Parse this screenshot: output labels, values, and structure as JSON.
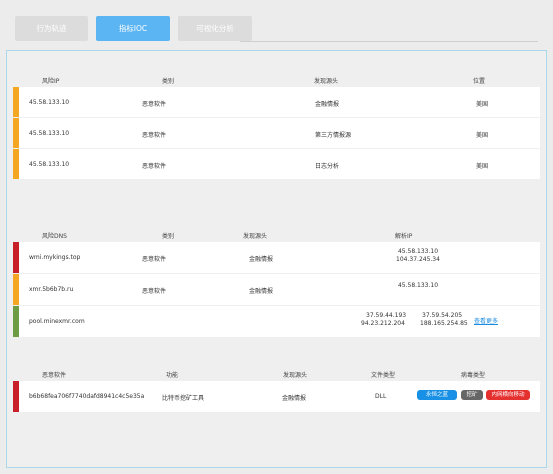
{
  "tabs": [
    {
      "label": "行为轨迹"
    },
    {
      "label": "指标IOC"
    },
    {
      "label": "可视化分析"
    }
  ],
  "ip_section": {
    "headers": [
      "风险IP",
      "类别",
      "发现源头",
      "位置"
    ],
    "rows": [
      {
        "ip": "45.58.133.10",
        "category": "恶意软件",
        "source": "金融情报",
        "location": "美国"
      },
      {
        "ip": "45.58.133.10",
        "category": "恶意软件",
        "source": "第三方情报源",
        "location": "美国"
      },
      {
        "ip": "45.58.133.10",
        "category": "恶意软件",
        "source": "日志分析",
        "location": "美国"
      }
    ]
  },
  "dns_section": {
    "headers": [
      "风险DNS",
      "类别",
      "发现源头",
      "解析IP"
    ],
    "rows": [
      {
        "dns": "wmi.mykings.top",
        "category": "恶意软件",
        "source": "金融情报",
        "ips": [
          "45.58.133.10",
          "104.37.245.34"
        ]
      },
      {
        "dns": "xmr.5b6b7b.ru",
        "category": "恶意软件",
        "source": "金融情报",
        "ips": [
          "45.58.133.10"
        ]
      },
      {
        "dns": "pool.minexmr.com",
        "category": "",
        "source": "",
        "ips_grid": [
          "37.59.44.193",
          "37.59.54.205",
          "94.23.212.204",
          "188.165.254.85"
        ],
        "more": "查看更多"
      }
    ]
  },
  "malware_section": {
    "headers": [
      "恶意软件",
      "功能",
      "发现源头",
      "文件类型",
      "病毒类型"
    ],
    "rows": [
      {
        "hash": "b6b68fea706f7740dafd8941c4c5e35a",
        "function": "比特币挖矿工具",
        "source": "金融情报",
        "file_type": "DLL",
        "tags": [
          "永恒之蓝",
          "挖矿",
          "内网横向移动"
        ]
      }
    ]
  },
  "colors": {
    "accent": "#5cb5f3",
    "orange": "#f5a623",
    "red": "#c8202a",
    "green": "#6d9c44"
  }
}
